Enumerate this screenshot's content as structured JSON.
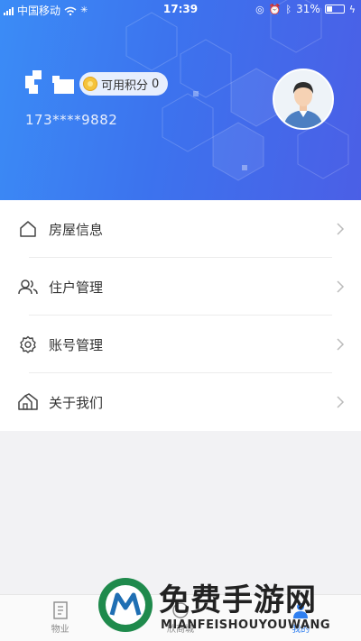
{
  "status_bar": {
    "carrier": "中国移动",
    "time": "17:39",
    "battery": "31%",
    "battery_level": 0.31
  },
  "profile": {
    "points_label": "可用积分",
    "points_value": "0",
    "phone": "173****9882"
  },
  "menu": {
    "items": [
      {
        "label": "房屋信息",
        "icon": "house-icon"
      },
      {
        "label": "住户管理",
        "icon": "residents-icon"
      },
      {
        "label": "账号管理",
        "icon": "gear-icon"
      },
      {
        "label": "关于我们",
        "icon": "about-house-icon"
      }
    ]
  },
  "tabbar": {
    "tabs": [
      {
        "label": "物业",
        "icon": "property-icon",
        "active": false
      },
      {
        "label": "欣商城",
        "icon": "mall-icon",
        "active": false
      },
      {
        "label": "我的",
        "icon": "user-icon",
        "active": true
      }
    ]
  },
  "watermark": {
    "title": "免费手游网",
    "subtitle": "MIANFEISHOUYOUWANG"
  },
  "colors": {
    "header_gradient_start": "#3b8cf6",
    "header_gradient_end": "#4b5fe6",
    "accent": "#2f7ff0"
  }
}
